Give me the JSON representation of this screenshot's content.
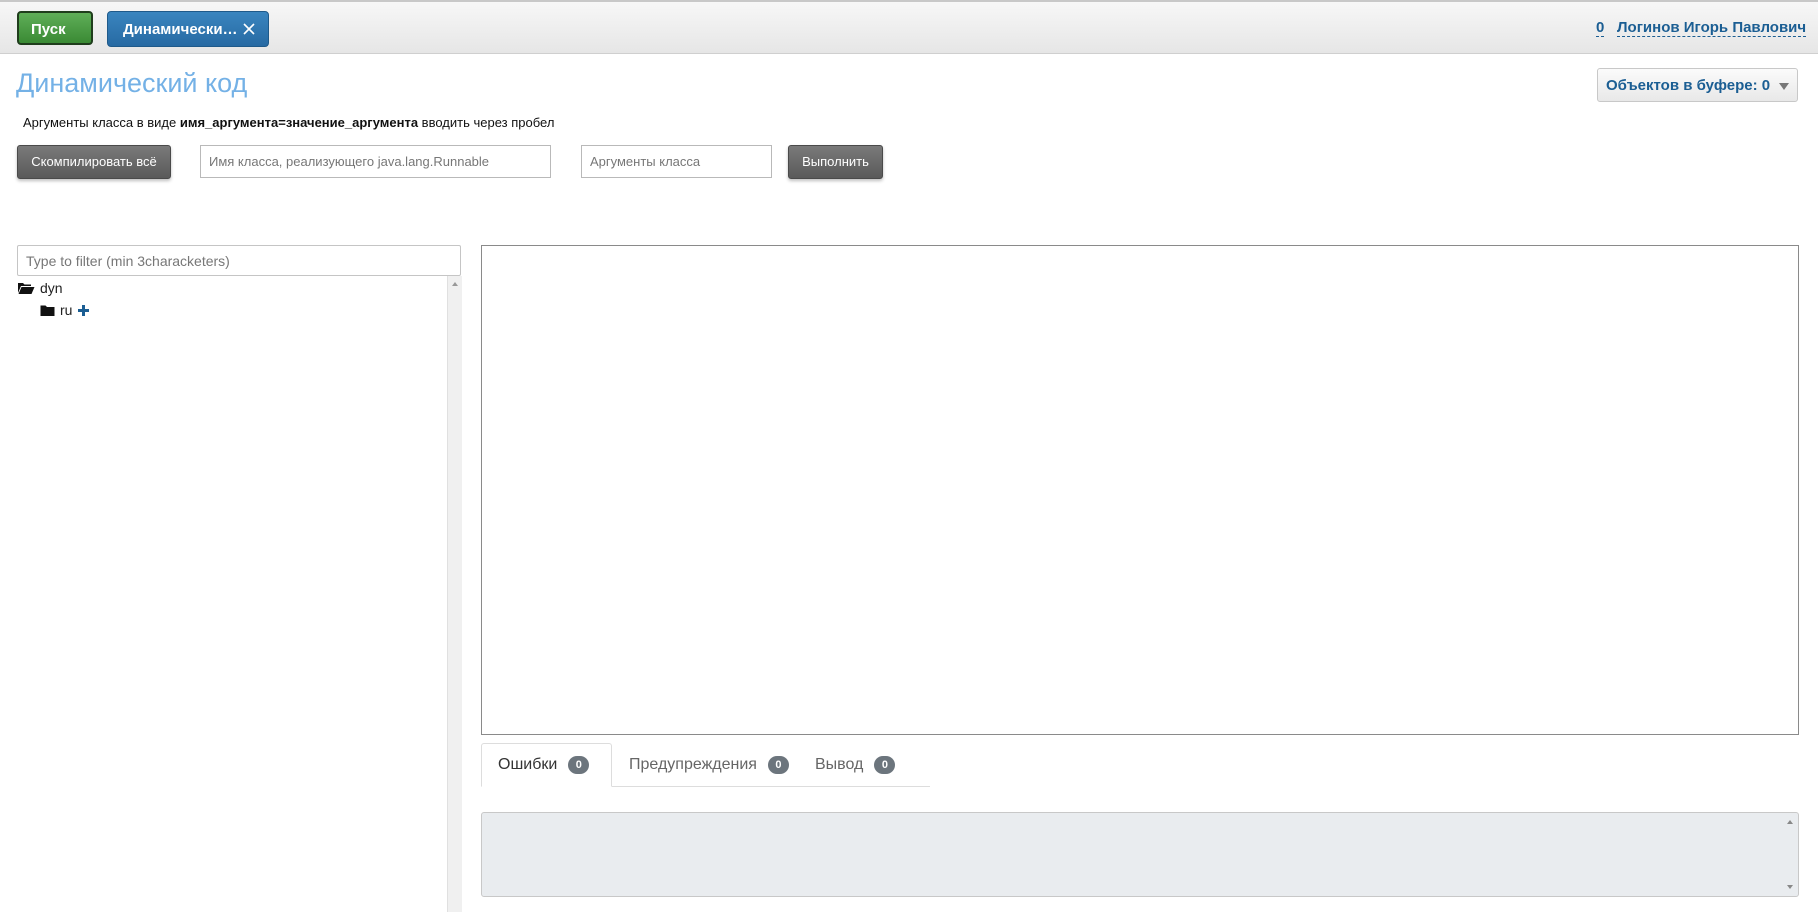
{
  "topbar": {
    "start_label": "Пуск",
    "task_tab_label": "Динамически…",
    "user_count": "0",
    "user_name": "Логинов Игорь Павлович"
  },
  "header": {
    "title": "Динамический код",
    "buffer_label": "Объектов в буфере: 0"
  },
  "hint": {
    "prefix": "Аргументы класса в виде ",
    "bold": "имя_аргумента=значение_аргумента",
    "suffix": " вводить через пробел"
  },
  "toolbar": {
    "compile_label": "Скомпилировать всё",
    "class_placeholder": "Имя класса, реализующего java.lang.Runnable",
    "class_value": "",
    "args_placeholder": "Аргументы класса",
    "args_value": "",
    "run_label": "Выполнить"
  },
  "tree": {
    "filter_placeholder": "Type to filter (min 3characketers)",
    "filter_value": "",
    "nodes": [
      {
        "label": "dyn",
        "icon": "folder-open-icon"
      },
      {
        "label": "ru",
        "icon": "folder-icon"
      }
    ]
  },
  "tabs": [
    {
      "label": "Ошибки",
      "count": "0",
      "active": true
    },
    {
      "label": "Предупреждения",
      "count": "0",
      "active": false
    },
    {
      "label": "Вывод",
      "count": "0",
      "active": false
    }
  ],
  "colors": {
    "start_green": "#3a8a34",
    "tab_blue": "#276aa3",
    "link_blue": "#1b5e93",
    "title_blue": "#74b1e6",
    "console_bg": "#e9ecef",
    "add_blue": "#1b5e93"
  }
}
